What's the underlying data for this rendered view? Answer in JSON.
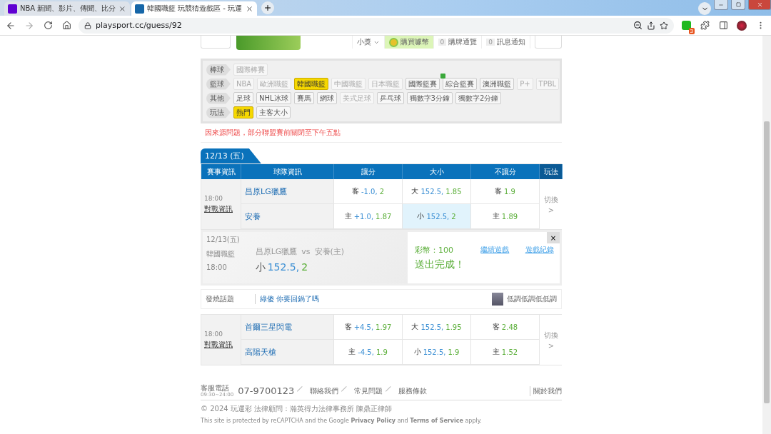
{
  "browser": {
    "tabs": [
      {
        "title": "NBA 新聞、影片、傳聞、比分",
        "selected": false
      },
      {
        "title": "韓國職籃 玩競猜遊戲區 - 玩運",
        "selected": true
      }
    ],
    "url": "playsport.cc/guess/92",
    "extension_badge": "3"
  },
  "user_menu": {
    "items": [
      {
        "label": "小獎",
        "kind": "dropdown",
        "highlighted": false
      },
      {
        "label": "購買噱幣",
        "kind": "coin",
        "highlighted": true
      },
      {
        "label": "購牌通覽",
        "kind": "count",
        "count": "0",
        "highlighted": false
      },
      {
        "label": "訊息通知",
        "kind": "count",
        "count": "0",
        "highlighted": false
      }
    ]
  },
  "filters": [
    {
      "label": "棒球",
      "chips": [
        {
          "text": "國際棒賽",
          "selected": false,
          "disabled": true
        }
      ]
    },
    {
      "label": "籃球",
      "chips": [
        {
          "text": "NBA",
          "selected": false,
          "disabled": true
        },
        {
          "text": "歐洲職籃",
          "selected": false,
          "disabled": true
        },
        {
          "text": "韓國職籃",
          "selected": true,
          "disabled": false
        },
        {
          "text": "中國職籃",
          "selected": false,
          "disabled": true
        },
        {
          "text": "日本職籃",
          "selected": false,
          "disabled": true
        },
        {
          "text": "國際籃賽",
          "selected": false,
          "disabled": false
        },
        {
          "text": "綜合籃賽",
          "selected": false,
          "disabled": false,
          "badge": true
        },
        {
          "text": "澳洲職籃",
          "selected": false,
          "disabled": false
        },
        {
          "text": "P+",
          "selected": false,
          "disabled": true
        },
        {
          "text": "TPBL",
          "selected": false,
          "disabled": true
        }
      ]
    },
    {
      "label": "其他",
      "chips": [
        {
          "text": "足球",
          "selected": false,
          "disabled": false
        },
        {
          "text": "NHL冰球",
          "selected": false,
          "disabled": false
        },
        {
          "text": "賽馬",
          "selected": false,
          "disabled": false
        },
        {
          "text": "網球",
          "selected": false,
          "disabled": false
        },
        {
          "text": "美式足球",
          "selected": false,
          "disabled": true
        },
        {
          "text": "乒乓球",
          "selected": false,
          "disabled": false
        },
        {
          "text": "獨數字3分鐘",
          "selected": false,
          "disabled": false
        },
        {
          "text": "獨數字2分鐘",
          "selected": false,
          "disabled": false
        }
      ]
    },
    {
      "label": "玩法",
      "chips": [
        {
          "text": "熱門",
          "selected": true,
          "disabled": false
        },
        {
          "text": "主客大小",
          "selected": false,
          "disabled": false
        }
      ]
    }
  ],
  "notice": "因來源問題，部分聯盟賽前關閉至下午五點",
  "date_tab": "12/13 (五)",
  "columns": [
    "賽事資訊",
    "球隊資訊",
    "讓分",
    "大小",
    "不讓分",
    "玩法"
  ],
  "games": [
    {
      "time": "18:00",
      "link": "對戰資訊",
      "switch": "切換",
      "switch_arrow": ">",
      "teams": [
        {
          "name": "昌原LG獵鷹",
          "spread": {
            "prefix": "客",
            "line": "-1.0,",
            "odds": "2",
            "selected": false
          },
          "total": {
            "prefix": "大",
            "line": "152.5,",
            "odds": "1.85",
            "selected": false
          },
          "moneyline": {
            "prefix": "客",
            "odds": "1.9",
            "selected": false
          }
        },
        {
          "name": "安養",
          "spread": {
            "prefix": "主",
            "line": "+1.0,",
            "odds": "1.87",
            "selected": false
          },
          "total": {
            "prefix": "小",
            "line": "152.5,",
            "odds": "2",
            "selected": true
          },
          "moneyline": {
            "prefix": "主",
            "odds": "1.89",
            "selected": false
          }
        }
      ]
    },
    {
      "time": "18:00",
      "link": "對戰資訊",
      "switch": "切換",
      "switch_arrow": ">",
      "teams": [
        {
          "name": "首爾三星閃電",
          "spread": {
            "prefix": "客",
            "line": "+4.5,",
            "odds": "1.97",
            "selected": false
          },
          "total": {
            "prefix": "大",
            "line": "152.5,",
            "odds": "1.95",
            "selected": false
          },
          "moneyline": {
            "prefix": "客",
            "odds": "2.48",
            "selected": false
          }
        },
        {
          "name": "高陽天槍",
          "spread": {
            "prefix": "主",
            "line": "-4.5,",
            "odds": "1.9",
            "selected": false
          },
          "total": {
            "prefix": "小",
            "line": "152.5,",
            "odds": "1.9",
            "selected": false
          },
          "moneyline": {
            "prefix": "主",
            "odds": "1.52",
            "selected": false
          }
        }
      ]
    }
  ],
  "confirmation": {
    "date": "12/13(五)",
    "league": "韓國職籃",
    "time": "18:00",
    "away": "昌原LG獵鷹",
    "vs": "vs",
    "home": "安養(主)",
    "pick_prefix": "小",
    "pick_line": "152.5,",
    "pick_odds": "2",
    "coins": "彩幣：100",
    "status": "送出完成！",
    "links": [
      "繼續遊戲",
      "遊戲紀錄"
    ],
    "close": "×"
  },
  "topic": {
    "label": "發燒話題",
    "link": "綠傻 你要回鍋了嗎",
    "user": "低調低調低低調"
  },
  "footer": {
    "phone_label": "客服電話",
    "hours": "09:30~24:00",
    "phone": "07-9700123",
    "links": [
      "聯絡我們",
      "常見問題",
      "服務條款"
    ],
    "about": "關於我們",
    "copyright": "© 2024 玩運彩 法律顧問：瀚英得力法律事務所 陳鼎正律師",
    "recaptcha": "This site is protected by reCAPTCHA and the Google **Privacy Policy** and **Terms of Service** apply."
  }
}
